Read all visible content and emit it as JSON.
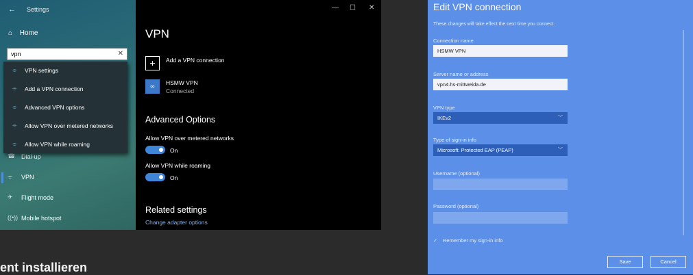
{
  "settings": {
    "window_title": "Settings",
    "back_icon": "back-arrow-icon",
    "home_label": "Home",
    "search_value": "vpn",
    "search_results": [
      {
        "label": "VPN settings",
        "icon": "vpn-icon"
      },
      {
        "label": "Add a VPN connection",
        "icon": "vpn-icon"
      },
      {
        "label": "Advanced VPN options",
        "icon": "vpn-icon"
      },
      {
        "label": "Allow VPN over metered networks",
        "icon": "vpn-icon"
      },
      {
        "label": "Allow VPN while roaming",
        "icon": "vpn-icon"
      }
    ],
    "nav_items": [
      {
        "label": "Dial-up",
        "icon": "dialup-icon"
      },
      {
        "label": "VPN",
        "icon": "vpn-icon",
        "selected": true
      },
      {
        "label": "Flight mode",
        "icon": "airplane-icon"
      },
      {
        "label": "Mobile hotspot",
        "icon": "hotspot-icon"
      }
    ]
  },
  "vpn_page": {
    "title": "VPN",
    "add_label": "Add a VPN connection",
    "connection": {
      "name": "HSMW VPN",
      "status": "Connected"
    },
    "advanced_title": "Advanced Options",
    "options": [
      {
        "label": "Allow VPN over metered networks",
        "state": "On"
      },
      {
        "label": "Allow VPN while roaming",
        "state": "On"
      }
    ],
    "related_title": "Related settings",
    "related_link": "Change adapter options"
  },
  "background_text": "ent installieren",
  "dialog": {
    "title": "Edit VPN connection",
    "subtitle": "These changes will take effect the next time you connect.",
    "connection_name_label": "Connection name",
    "connection_name": "HSMW VPN",
    "server_label": "Server name or address",
    "server": "vpn4.hs-mittweida.de",
    "vpn_type_label": "VPN type",
    "vpn_type": "IKEv2",
    "signin_label": "Type of sign-in info",
    "signin": "Microsoft: Protected EAP (PEAP)",
    "username_label": "Username (optional)",
    "password_label": "Password (optional)",
    "remember_label": "Remember my sign-in info",
    "save_label": "Save",
    "cancel_label": "Cancel"
  },
  "colors": {
    "accent": "#3f86d8",
    "dialog_bg": "#5b8fe8"
  }
}
